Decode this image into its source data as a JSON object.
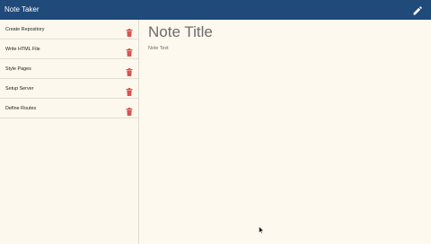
{
  "navbar": {
    "brand": "Note Taker",
    "new_note_icon": "pencil-icon"
  },
  "notes": [
    {
      "title": "Create Repository",
      "delete_icon": "trash-icon"
    },
    {
      "title": "Write HTML File",
      "delete_icon": "trash-icon"
    },
    {
      "title": "Style Pages",
      "delete_icon": "trash-icon"
    },
    {
      "title": "Setup Server",
      "delete_icon": "trash-icon"
    },
    {
      "title": "Define Routes",
      "delete_icon": "trash-icon"
    }
  ],
  "editor": {
    "title_placeholder": "Note Title",
    "text_placeholder": "Note Text"
  },
  "colors": {
    "navbar": "#1f4a7a",
    "background": "#fdf9ef",
    "delete": "#d9534f"
  }
}
